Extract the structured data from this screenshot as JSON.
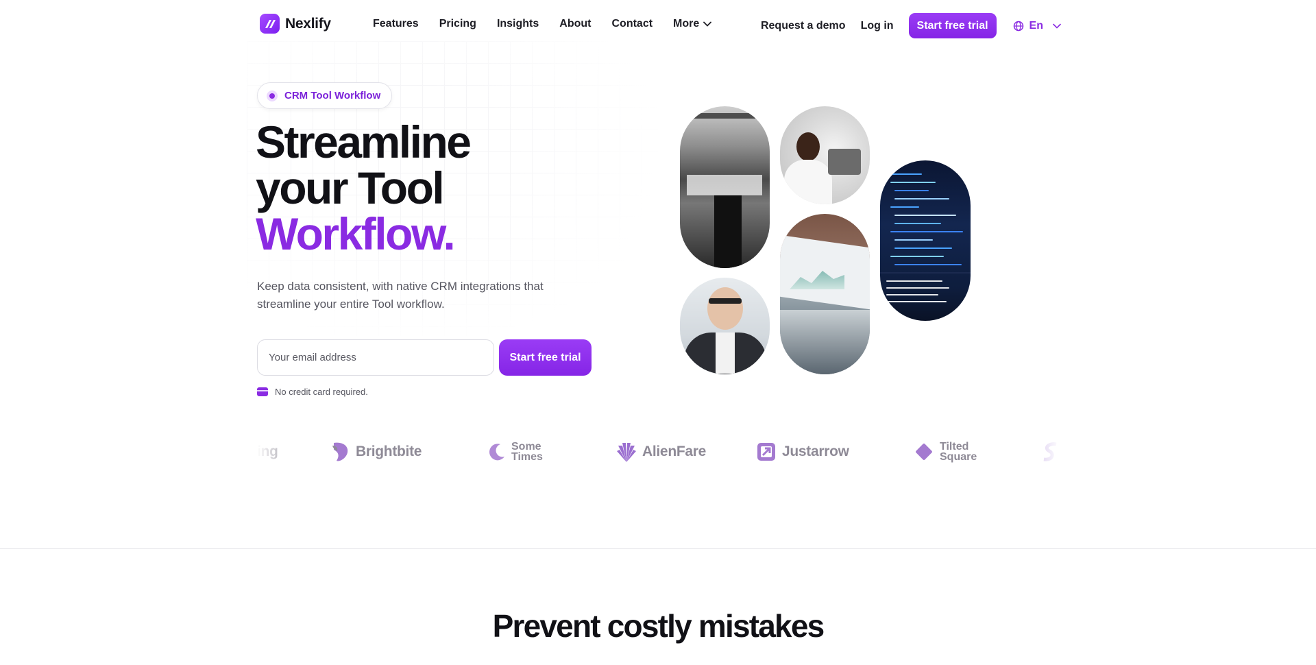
{
  "nav": {
    "brand": "Nexlify",
    "links": [
      "Features",
      "Pricing",
      "Insights",
      "About",
      "Contact"
    ],
    "more_label": "More",
    "request_demo": "Request a demo",
    "login": "Log in",
    "cta": "Start free trial",
    "language": "En"
  },
  "hero": {
    "badge": "CRM Tool Workflow",
    "title_line1": "Streamline",
    "title_line2": "your Tool",
    "title_line3": "Workflow.",
    "subtitle": "Keep data consistent, with native CRM integrations that streamline your entire Tool workflow.",
    "email_placeholder": "Your email address",
    "cta": "Start free trial",
    "note": "No credit card required."
  },
  "logos": {
    "partial_left": "ing",
    "items": [
      {
        "name": "Brightbite",
        "icon": "brightbite-logo-icon"
      },
      {
        "name_line1": "Some",
        "name_line2": "Times",
        "icon": "sometimes-logo-icon"
      },
      {
        "name": "AlienFare",
        "icon": "alienfare-logo-icon"
      },
      {
        "name": "Justarrow",
        "icon": "justarrow-logo-icon"
      },
      {
        "name_line1": "Tilted",
        "name_line2": "Square",
        "icon": "tiltedsquare-logo-icon"
      }
    ]
  },
  "section": {
    "title": "Prevent costly mistakes"
  },
  "colors": {
    "accent": "#8a2be2",
    "logo_gray": "#8e8a96",
    "text": "#111116"
  }
}
